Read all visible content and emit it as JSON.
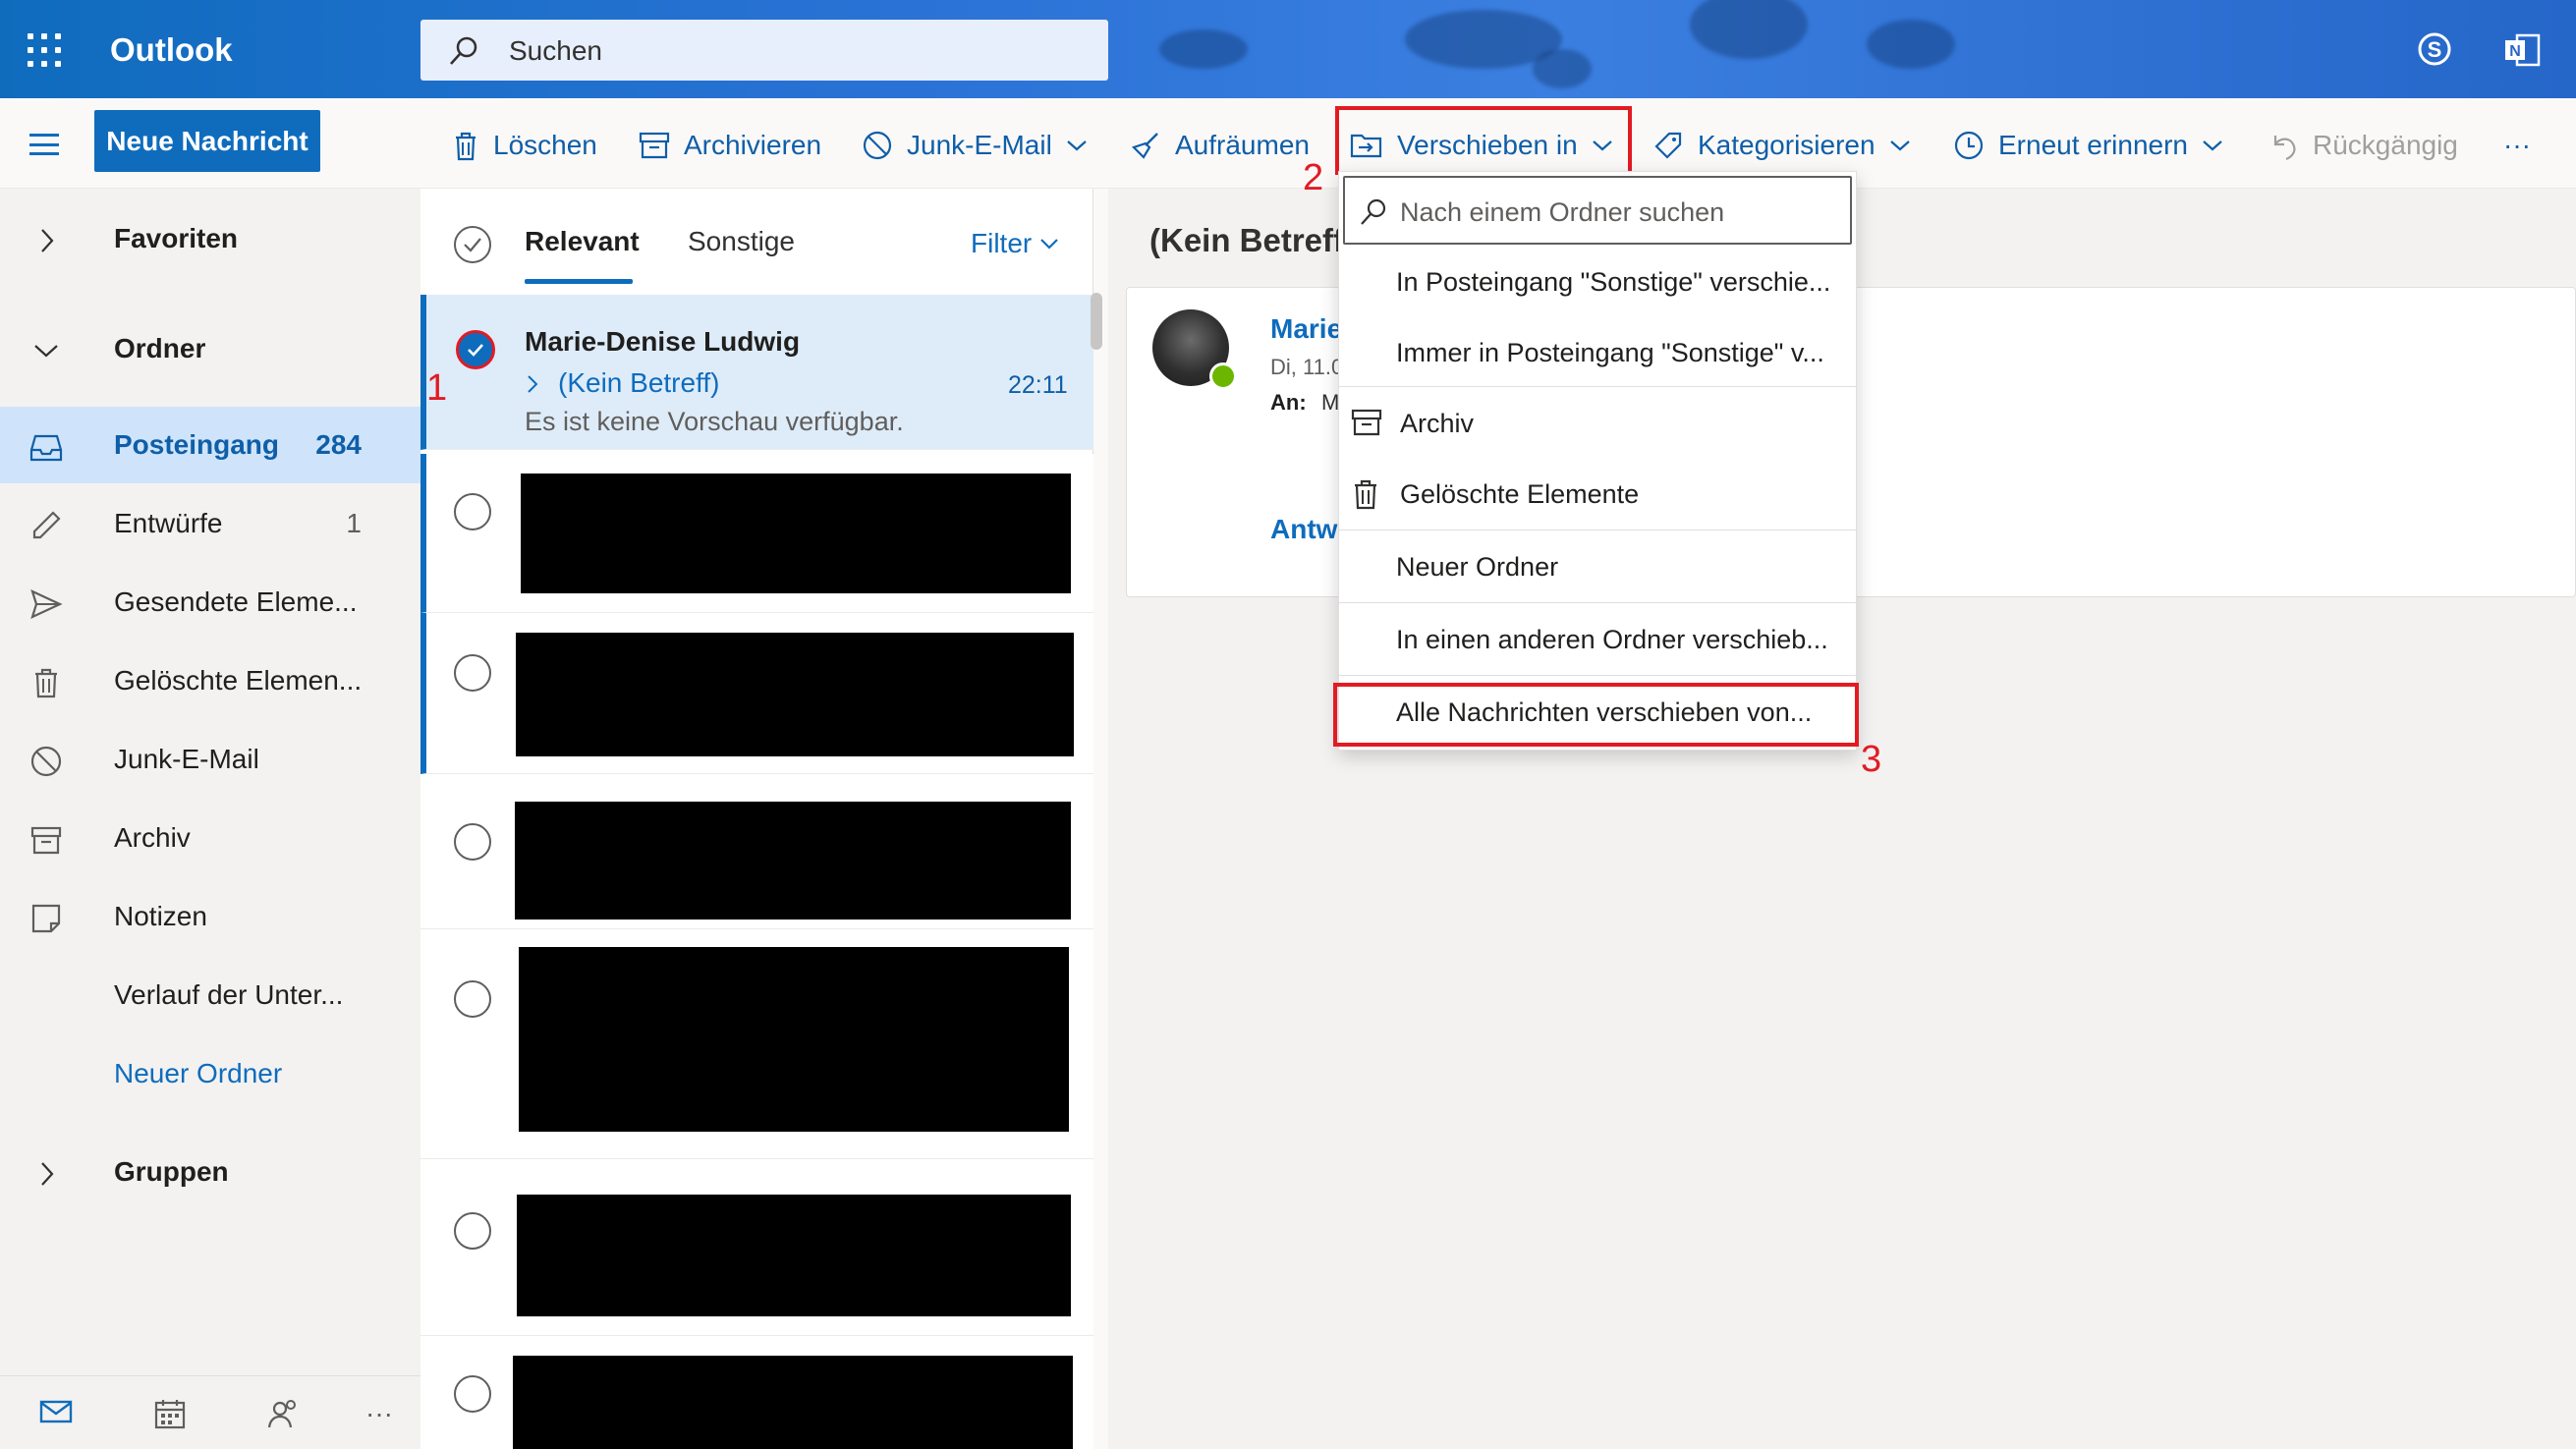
{
  "app": {
    "title": "Outlook"
  },
  "search": {
    "placeholder": "Suchen"
  },
  "toolbar": {
    "new_message": "Neue Nachricht",
    "delete": "Löschen",
    "archive": "Archivieren",
    "junk": "Junk-E-Mail",
    "sweep": "Aufräumen",
    "move_to": "Verschieben in",
    "categorize": "Kategorisieren",
    "snooze": "Erneut erinnern",
    "undo": "Rückgängig",
    "more": "···"
  },
  "nav": {
    "favorites": "Favoriten",
    "folders": "Ordner",
    "items": [
      {
        "label": "Posteingang",
        "count": "284",
        "icon": "inbox-icon",
        "selected": true
      },
      {
        "label": "Entwürfe",
        "count": "1",
        "icon": "pencil-icon"
      },
      {
        "label": "Gesendete Eleme...",
        "count": "",
        "icon": "send-icon"
      },
      {
        "label": "Gelöschte Elemen...",
        "count": "",
        "icon": "trash-icon"
      },
      {
        "label": "Junk-E-Mail",
        "count": "",
        "icon": "block-icon"
      },
      {
        "label": "Archiv",
        "count": "",
        "icon": "archive-icon"
      },
      {
        "label": "Notizen",
        "count": "",
        "icon": "note-icon"
      },
      {
        "label": "Verlauf der Unter...",
        "count": "",
        "icon": ""
      }
    ],
    "new_folder": "Neuer Ordner",
    "groups": "Gruppen"
  },
  "message_list": {
    "tabs": [
      "Relevant",
      "Sonstige"
    ],
    "active_tab": "Relevant",
    "filter": "Filter",
    "messages": [
      {
        "sender": "Marie-Denise Ludwig",
        "subject": "(Kein Betreff)",
        "time": "22:11",
        "preview": "Es ist keine Vorschau verfügbar.",
        "selected": true
      }
    ],
    "redacted_count": 6
  },
  "reading_pane": {
    "subject": "(Kein Betreff",
    "sender": "Marie-",
    "date": "Di, 11.05",
    "to_label": "An:",
    "to_value": "Ma",
    "reply": "Antwo"
  },
  "move_menu": {
    "search_placeholder": "Nach einem Ordner suchen",
    "items": [
      "In Posteingang \"Sonstige\" verschie...",
      "Immer in Posteingang \"Sonstige\" v...",
      "Archiv",
      "Gelöschte Elemente",
      "Neuer Ordner",
      "In einen anderen Ordner verschieb...",
      "Alle Nachrichten verschieben von..."
    ]
  },
  "annotations": [
    "1",
    "2",
    "3"
  ],
  "colors": {
    "accent": "#0f6cbd",
    "highlight_box": "#e21b23",
    "selected_row": "#deecf9"
  }
}
